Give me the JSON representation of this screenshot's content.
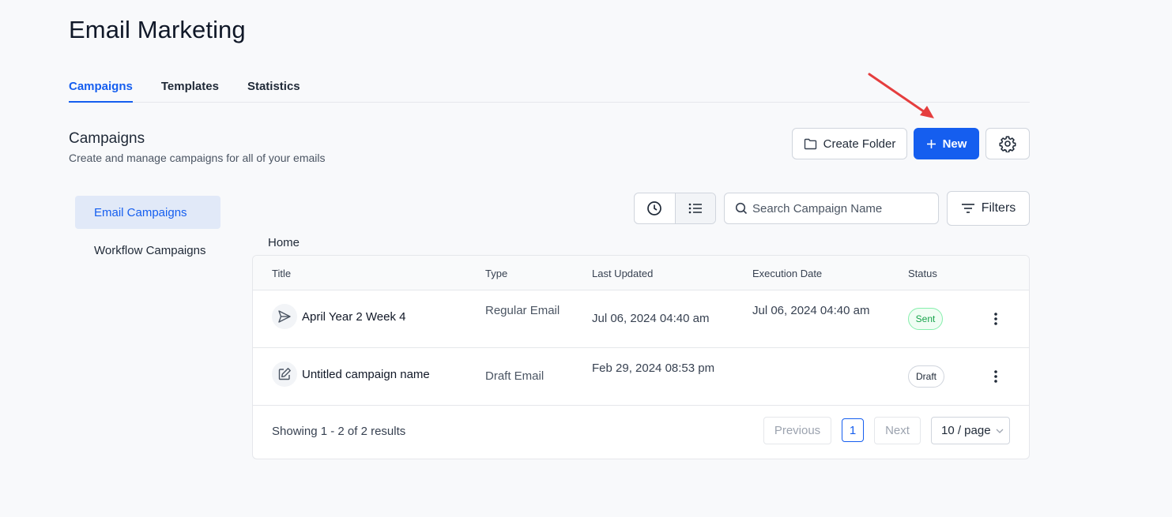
{
  "header": {
    "title": "Email Marketing"
  },
  "tabs": [
    {
      "label": "Campaigns",
      "active": true
    },
    {
      "label": "Templates",
      "active": false
    },
    {
      "label": "Statistics",
      "active": false
    }
  ],
  "section": {
    "title": "Campaigns",
    "subtitle": "Create and manage campaigns for all of your emails"
  },
  "actions": {
    "create_folder": "Create Folder",
    "new": "New",
    "settings_icon": "gear-icon"
  },
  "sidebar": {
    "items": [
      {
        "label": "Email Campaigns",
        "active": true
      },
      {
        "label": "Workflow Campaigns",
        "active": false
      }
    ]
  },
  "toolbar": {
    "search_placeholder": "Search Campaign Name",
    "filters_label": "Filters"
  },
  "breadcrumb": "Home",
  "table": {
    "columns": [
      "Title",
      "Type",
      "Last Updated",
      "Execution Date",
      "Status"
    ],
    "rows": [
      {
        "icon": "send-icon",
        "title": "April Year 2 Week 4",
        "type": "Regular Email",
        "last_updated": "Jul 06, 2024 04:40 am",
        "execution_date": "Jul 06, 2024 04:40 am",
        "status": "Sent"
      },
      {
        "icon": "edit-icon",
        "title": "Untitled campaign name",
        "type": "Draft Email",
        "last_updated": "Feb 29, 2024 08:53 pm",
        "execution_date": "",
        "status": "Draft"
      }
    ],
    "footer": {
      "showing": "Showing 1 - 2 of 2 results",
      "previous": "Previous",
      "current_page": "1",
      "next": "Next",
      "per_page": "10 / page"
    }
  },
  "colors": {
    "accent": "#155eef",
    "sent": "#16a34a",
    "annotation_arrow": "#e53e3e"
  }
}
